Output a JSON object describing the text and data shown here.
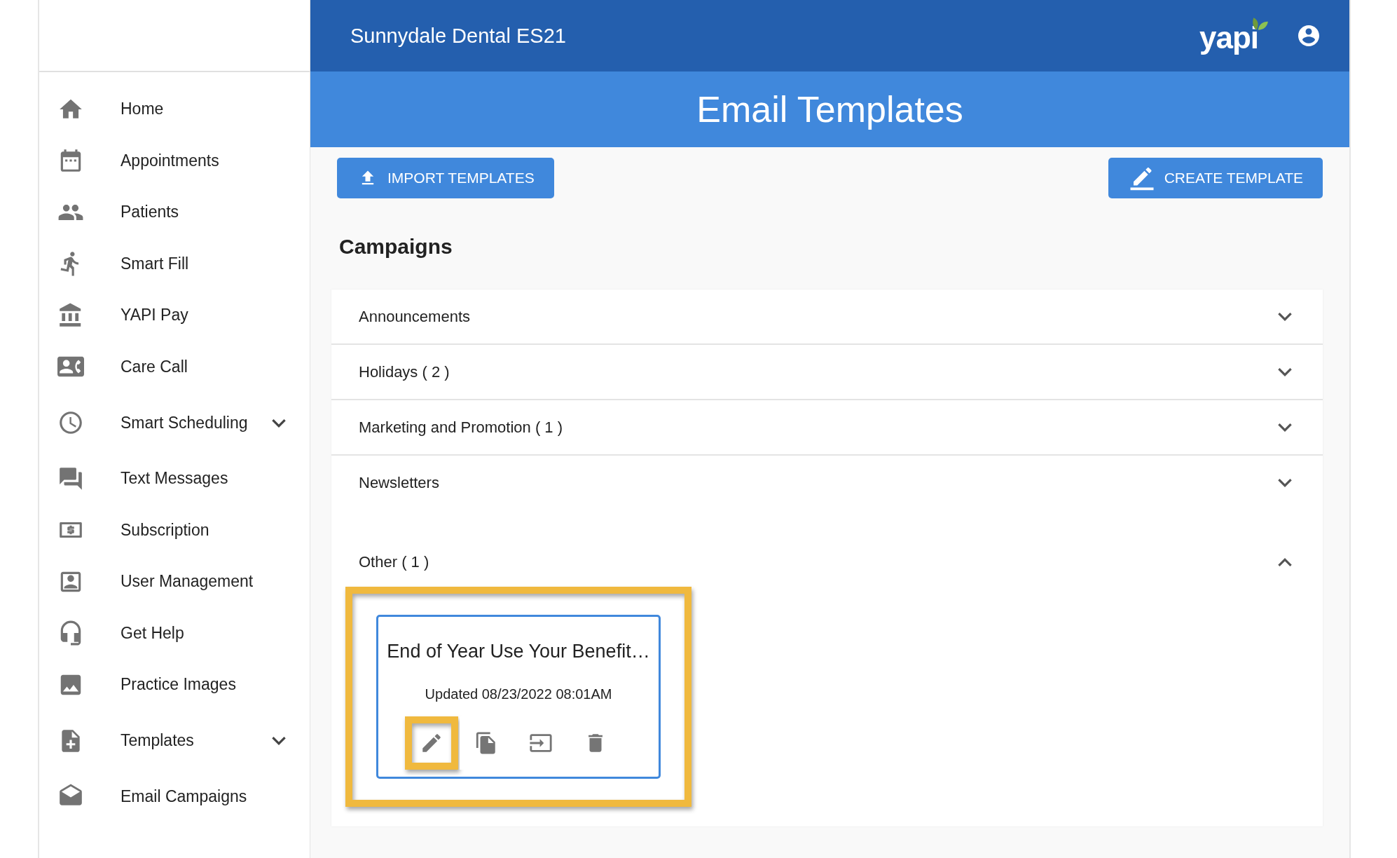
{
  "header": {
    "practice_name": "Sunnydale Dental ES21",
    "logo": "yapi"
  },
  "sidebar": {
    "items": [
      {
        "label": "Home",
        "kind": "home",
        "submenu": false
      },
      {
        "label": "Appointments",
        "kind": "calendar",
        "submenu": false
      },
      {
        "label": "Patients",
        "kind": "people",
        "submenu": false
      },
      {
        "label": "Smart Fill",
        "kind": "run",
        "submenu": false
      },
      {
        "label": "YAPI Pay",
        "kind": "bank",
        "submenu": false
      },
      {
        "label": "Care Call",
        "kind": "contact",
        "submenu": false
      },
      {
        "label": "Smart Scheduling",
        "kind": "clock",
        "submenu": true
      },
      {
        "label": "Text Messages",
        "kind": "chat",
        "submenu": false
      },
      {
        "label": "Subscription",
        "kind": "money",
        "submenu": false
      },
      {
        "label": "User Management",
        "kind": "user",
        "submenu": false
      },
      {
        "label": "Get Help",
        "kind": "headset",
        "submenu": false
      },
      {
        "label": "Practice Images",
        "kind": "image",
        "submenu": false
      },
      {
        "label": "Templates",
        "kind": "file",
        "submenu": true
      },
      {
        "label": "Email Campaigns",
        "kind": "mail",
        "submenu": false
      }
    ]
  },
  "page_title": "Email Templates",
  "import_button": "IMPORT TEMPLATES",
  "create_button": "CREATE TEMPLATE",
  "section_title": "Campaigns",
  "categories": [
    {
      "label": "Announcements",
      "expanded": false
    },
    {
      "label": "Holidays ( 2 )",
      "expanded": false
    },
    {
      "label": "Marketing and Promotion ( 1 )",
      "expanded": false
    },
    {
      "label": "Newsletters",
      "expanded": false
    },
    {
      "label": "Other ( 1 )",
      "expanded": true,
      "templates": [
        {
          "title": "End of Year Use Your Benefit…",
          "updated": "Updated 08/23/2022 08:01AM",
          "highlighted": true,
          "actions": [
            {
              "kind": "edit",
              "highlighted": true
            },
            {
              "kind": "copy",
              "highlighted": false
            },
            {
              "kind": "export",
              "highlighted": false
            },
            {
              "kind": "delete",
              "highlighted": false
            }
          ]
        }
      ]
    }
  ]
}
